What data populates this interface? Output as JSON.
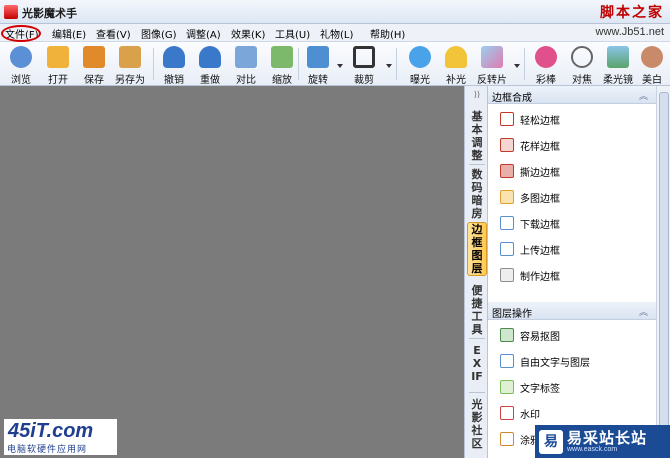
{
  "window": {
    "title": "光影魔术手",
    "watermark_site": "脚本之家",
    "watermark_url": "www.Jb51.net"
  },
  "menu": [
    {
      "label": "文件(F)"
    },
    {
      "label": "编辑(E)"
    },
    {
      "label": "查看(V)"
    },
    {
      "label": "图像(G)"
    },
    {
      "label": "调整(A)"
    },
    {
      "label": "效果(K)"
    },
    {
      "label": "工具(U)"
    },
    {
      "label": "礼物(L)"
    },
    {
      "label": "帮助(H)"
    }
  ],
  "toolbar": [
    {
      "label": "浏览",
      "icon": "eye-icon",
      "color": "#5b8fd6"
    },
    {
      "label": "打开",
      "icon": "folder-icon",
      "color": "#f0b23a"
    },
    {
      "label": "保存",
      "icon": "save-icon",
      "color": "#e08a2c"
    },
    {
      "label": "另存为",
      "icon": "save-as-icon",
      "color": "#d9a24a"
    },
    {
      "label": "撤销",
      "icon": "undo-icon",
      "color": "#3a79c9"
    },
    {
      "label": "重做",
      "icon": "redo-icon",
      "color": "#3a79c9"
    },
    {
      "label": "对比",
      "icon": "compare-icon",
      "color": "#7aa6d9"
    },
    {
      "label": "缩放",
      "icon": "zoom-icon",
      "color": "#7cb96a"
    },
    {
      "label": "旋转",
      "icon": "rotate-icon",
      "color": "#4d8fd1"
    },
    {
      "label": "裁剪",
      "icon": "crop-icon",
      "color": "#333333"
    },
    {
      "label": "曝光",
      "icon": "exposure-icon",
      "color": "#4aa3e8"
    },
    {
      "label": "补光",
      "icon": "fill-light-icon",
      "color": "#f2c43a"
    },
    {
      "label": "反转片",
      "icon": "reversal-film-icon",
      "color": "#9ad0f0"
    },
    {
      "label": "彩棒",
      "icon": "color-wand-icon",
      "color": "#e0508c"
    },
    {
      "label": "对焦",
      "icon": "focus-icon",
      "color": "#666666"
    },
    {
      "label": "柔光镜",
      "icon": "soft-light-icon",
      "color": "#5aa36a"
    },
    {
      "label": "美白",
      "icon": "whiten-icon",
      "color": "#c98a6a"
    }
  ],
  "vertical_tabs": [
    {
      "label": "基本调整",
      "active": false
    },
    {
      "label": "数码暗房",
      "active": false
    },
    {
      "label": "边框图层",
      "active": true
    },
    {
      "label": "便捷工具",
      "active": false
    },
    {
      "label": "EXIF",
      "active": false
    },
    {
      "label": "光影社区",
      "active": false
    }
  ],
  "panel": {
    "groups": [
      {
        "title": "边框合成",
        "items": [
          {
            "label": "轻松边框",
            "color": "#c0392b"
          },
          {
            "label": "花样边框",
            "color": "#c0392b"
          },
          {
            "label": "撕边边框",
            "color": "#c0392b"
          },
          {
            "label": "多图边框",
            "color": "#e0a030"
          },
          {
            "label": "下载边框",
            "color": "#5a8fd0"
          },
          {
            "label": "上传边框",
            "color": "#5a8fd0"
          },
          {
            "label": "制作边框",
            "color": "#8e8e8e"
          }
        ]
      },
      {
        "title": "图层操作",
        "items": [
          {
            "label": "容易抠图",
            "color": "#4a8a4a"
          },
          {
            "label": "自由文字与图层",
            "color": "#5a8fd0"
          },
          {
            "label": "文字标签",
            "color": "#7bbf5a"
          },
          {
            "label": "水印",
            "color": "#d04040"
          },
          {
            "label": "涂鸦",
            "color": "#d08a30"
          }
        ]
      }
    ]
  },
  "logos": {
    "site45_main": "45iT.com",
    "site45_sub": "电脑软硬件应用网",
    "yicai_mark": "易",
    "yicai_name": "易采站长站",
    "yicai_url": "www.easck.com"
  }
}
